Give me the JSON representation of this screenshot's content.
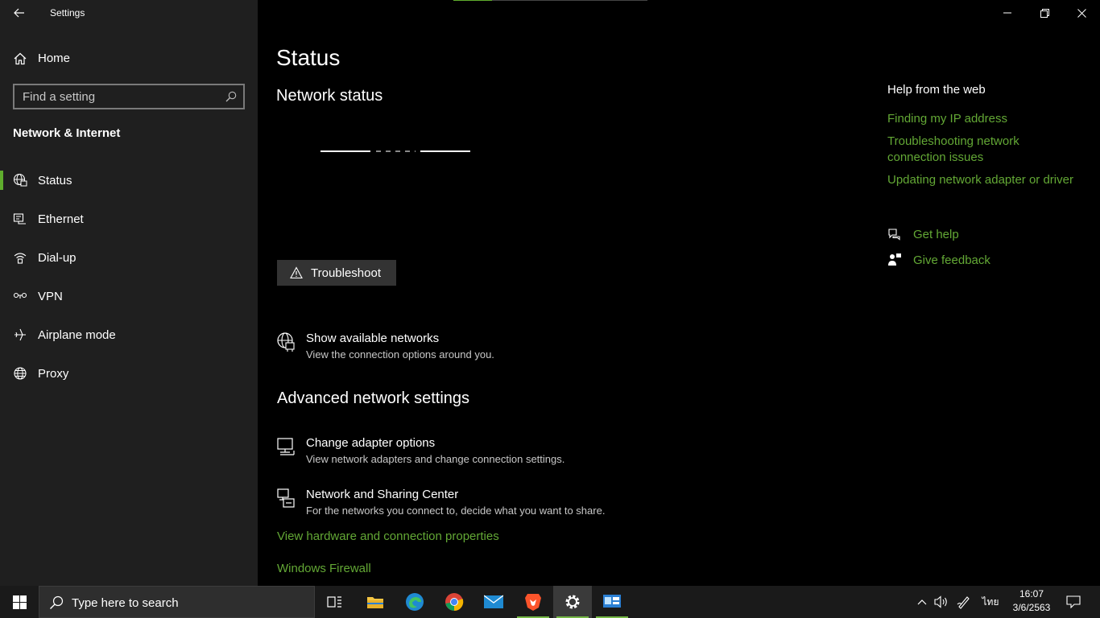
{
  "window": {
    "title": "Settings",
    "controls": [
      "minimize-icon",
      "restore-icon",
      "close-icon"
    ]
  },
  "sidebar": {
    "home_label": "Home",
    "search_placeholder": "Find a setting",
    "section_title": "Network & Internet",
    "items": [
      {
        "label": "Status",
        "icon": "globe-status-icon",
        "active": true
      },
      {
        "label": "Ethernet",
        "icon": "ethernet-icon",
        "active": false
      },
      {
        "label": "Dial-up",
        "icon": "dialup-icon",
        "active": false
      },
      {
        "label": "VPN",
        "icon": "vpn-icon",
        "active": false
      },
      {
        "label": "Airplane mode",
        "icon": "airplane-icon",
        "active": false
      },
      {
        "label": "Proxy",
        "icon": "globe-icon",
        "active": false
      }
    ]
  },
  "main": {
    "title": "Status",
    "network_status_title": "Network status",
    "troubleshoot_label": "Troubleshoot",
    "show_networks": {
      "title": "Show available networks",
      "desc": "View the connection options around you."
    },
    "advanced_title": "Advanced network settings",
    "change_adapter": {
      "title": "Change adapter options",
      "desc": "View network adapters and change connection settings."
    },
    "sharing_center": {
      "title": "Network and Sharing Center",
      "desc": "For the networks you connect to, decide what you want to share."
    },
    "link_hardware": "View hardware and connection properties",
    "link_firewall": "Windows Firewall"
  },
  "help": {
    "title": "Help from the web",
    "links": [
      "Finding my IP address",
      "Troubleshooting network connection issues",
      "Updating network adapter or driver"
    ],
    "get_help": "Get help",
    "give_feedback": "Give feedback"
  },
  "taskbar": {
    "search_placeholder": "Type here to search",
    "time": "16:07",
    "date": "3/6/2563",
    "language": "ไทย"
  },
  "colors": {
    "accent": "#63a835",
    "sidebar_bg": "#1f1f1f",
    "main_bg": "#000000"
  }
}
